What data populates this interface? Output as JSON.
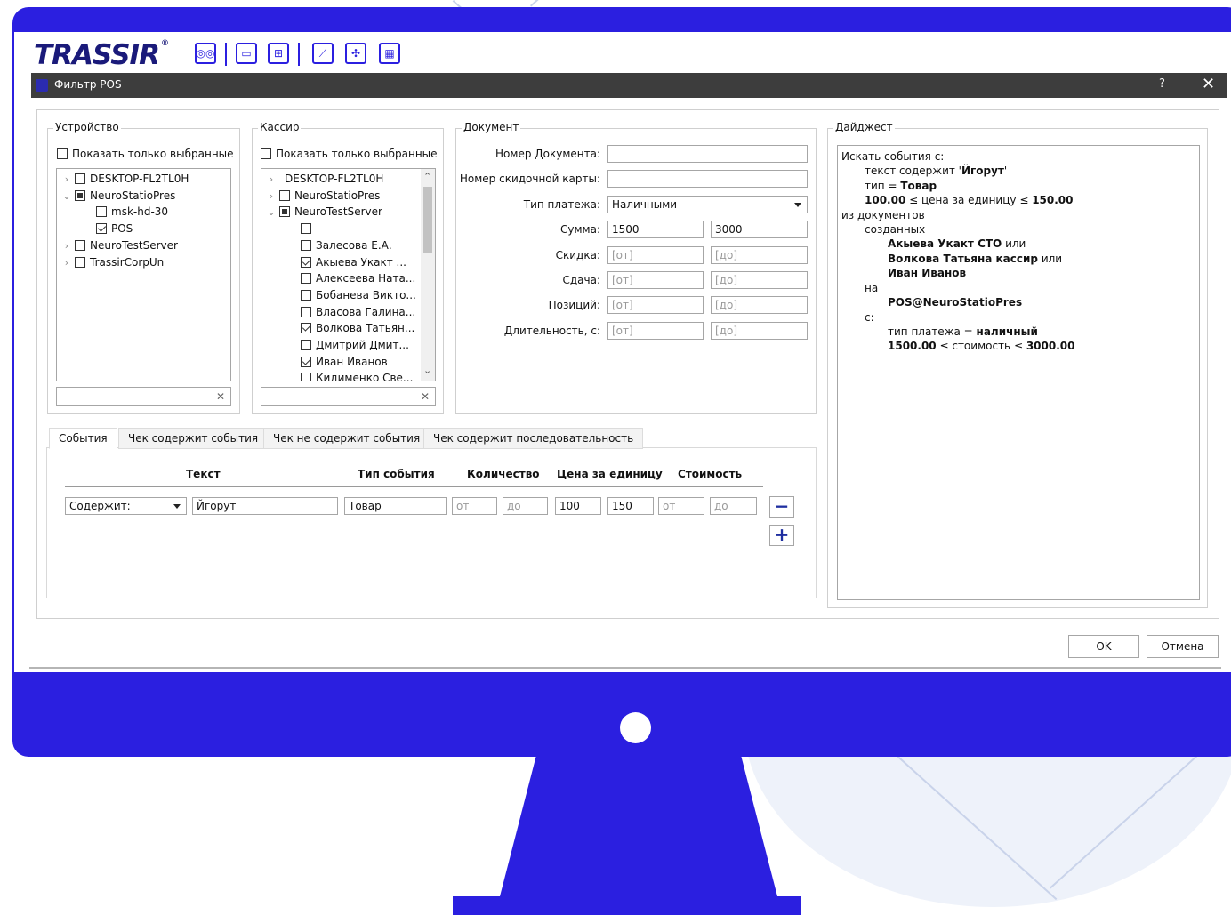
{
  "app": {
    "logo": "TRASSIR",
    "logo_mark": "®",
    "toolbar_icons": [
      "cassette-icon",
      "monitor-icon",
      "screen-layout-icon",
      "magic-wand-icon",
      "puzzle-icon",
      "edit-grid-icon"
    ]
  },
  "dialog": {
    "title": "Фильтр POS",
    "help": "?",
    "close": "✕"
  },
  "device": {
    "title": "Устройство",
    "show_selected": "Показать только выбранные",
    "items": [
      {
        "label": "DESKTOP-FL2TL0H",
        "level": 0,
        "expander": "›",
        "state": "unchecked"
      },
      {
        "label": "NeuroStatioPres",
        "level": 0,
        "expander": "⌄",
        "state": "partial"
      },
      {
        "label": "msk-hd-30",
        "level": 1,
        "expander": "",
        "state": "unchecked"
      },
      {
        "label": "POS",
        "level": 1,
        "expander": "",
        "state": "checked"
      },
      {
        "label": "NeuroTestServer",
        "level": 0,
        "expander": "›",
        "state": "unchecked"
      },
      {
        "label": "TrassirCorpUn",
        "level": 0,
        "expander": "›",
        "state": "unchecked"
      }
    ],
    "filter_clear": "✕"
  },
  "cashier": {
    "title": "Кассир",
    "show_selected": "Показать только выбранные",
    "items": [
      {
        "label": "DESKTOP-FL2TL0H",
        "level": 0,
        "expander": "›",
        "state": "none"
      },
      {
        "label": "NeuroStatioPres",
        "level": 0,
        "expander": "›",
        "state": "unchecked"
      },
      {
        "label": "NeuroTestServer",
        "level": 0,
        "expander": "⌄",
        "state": "partial"
      },
      {
        "label": "",
        "level": 1,
        "expander": "",
        "state": "unchecked"
      },
      {
        "label": "Залесова Е.А.",
        "level": 1,
        "expander": "",
        "state": "unchecked"
      },
      {
        "label": "Акыева Укакт ...",
        "level": 1,
        "expander": "",
        "state": "checked"
      },
      {
        "label": "Алексеева Ната...",
        "level": 1,
        "expander": "",
        "state": "unchecked"
      },
      {
        "label": "Бобанева Викто...",
        "level": 1,
        "expander": "",
        "state": "unchecked"
      },
      {
        "label": "Власова Галина...",
        "level": 1,
        "expander": "",
        "state": "unchecked"
      },
      {
        "label": "Волкова Татьян...",
        "level": 1,
        "expander": "",
        "state": "checked"
      },
      {
        "label": "Дмитрий Дмит...",
        "level": 1,
        "expander": "",
        "state": "unchecked"
      },
      {
        "label": "Иван Иванов",
        "level": 1,
        "expander": "",
        "state": "checked"
      },
      {
        "label": "Кидименко Све...",
        "level": 1,
        "expander": "",
        "state": "unchecked"
      }
    ],
    "scroll_up": "⌃",
    "scroll_down": "⌄",
    "filter_clear": "✕"
  },
  "document": {
    "title": "Документ",
    "doc_number_label": "Номер Документа:",
    "doc_number_value": "",
    "card_label": "Номер скидочной карты:",
    "card_value": "",
    "payment_label": "Тип платежа:",
    "payment_value": "Наличными",
    "sum_label": "Сумма:",
    "sum_from": "1500",
    "sum_to": "3000",
    "discount_label": "Скидка:",
    "change_label": "Сдача:",
    "positions_label": "Позиций:",
    "duration_label": "Длительность, с:",
    "ph_from": "[от]",
    "ph_to": "[до]"
  },
  "digest": {
    "title": "Дайджест",
    "l1": "Искать события с:",
    "l2a": "текст содержит '",
    "l2b": "Йгорут",
    "l2c": "'",
    "l3a": "тип = ",
    "l3b": "Товар",
    "l4a": "100.00",
    "l4b": " ≤ цена за единицу ≤ ",
    "l4c": "150.00",
    "l5": "из документов",
    "l6": "созданных",
    "l7a": "Акыева Укакт СТО",
    "l7b": " или",
    "l8a": "Волкова Татьяна кассир",
    "l8b": " или",
    "l9": "Иван Иванов",
    "l10": "на",
    "l11": "POS@NeuroStatioPres",
    "l12": "с:",
    "l13a": "тип платежа = ",
    "l13b": "наличный",
    "l14a": "1500.00",
    "l14b": " ≤ стоимость ≤ ",
    "l14c": "3000.00"
  },
  "tabs": [
    {
      "label": "События",
      "active": true
    },
    {
      "label": "Чек содержит события",
      "active": false
    },
    {
      "label": "Чек не содержит события",
      "active": false
    },
    {
      "label": "Чек содержит последовательность",
      "active": false
    }
  ],
  "events": {
    "headers": {
      "text": "Текст",
      "type": "Тип события",
      "qty": "Количество",
      "unit": "Цена за единицу",
      "cost": "Стоимость"
    },
    "row": {
      "match_mode": "Содержит:",
      "text": "Йгорут",
      "type": "Товар",
      "qty_from": "от",
      "qty_to": "до",
      "unit_from": "100",
      "unit_to": "150",
      "cost_from": "от",
      "cost_to": "до"
    },
    "remove": "−",
    "add": "+"
  },
  "footer": {
    "ok": "OK",
    "cancel": "Отмена"
  }
}
